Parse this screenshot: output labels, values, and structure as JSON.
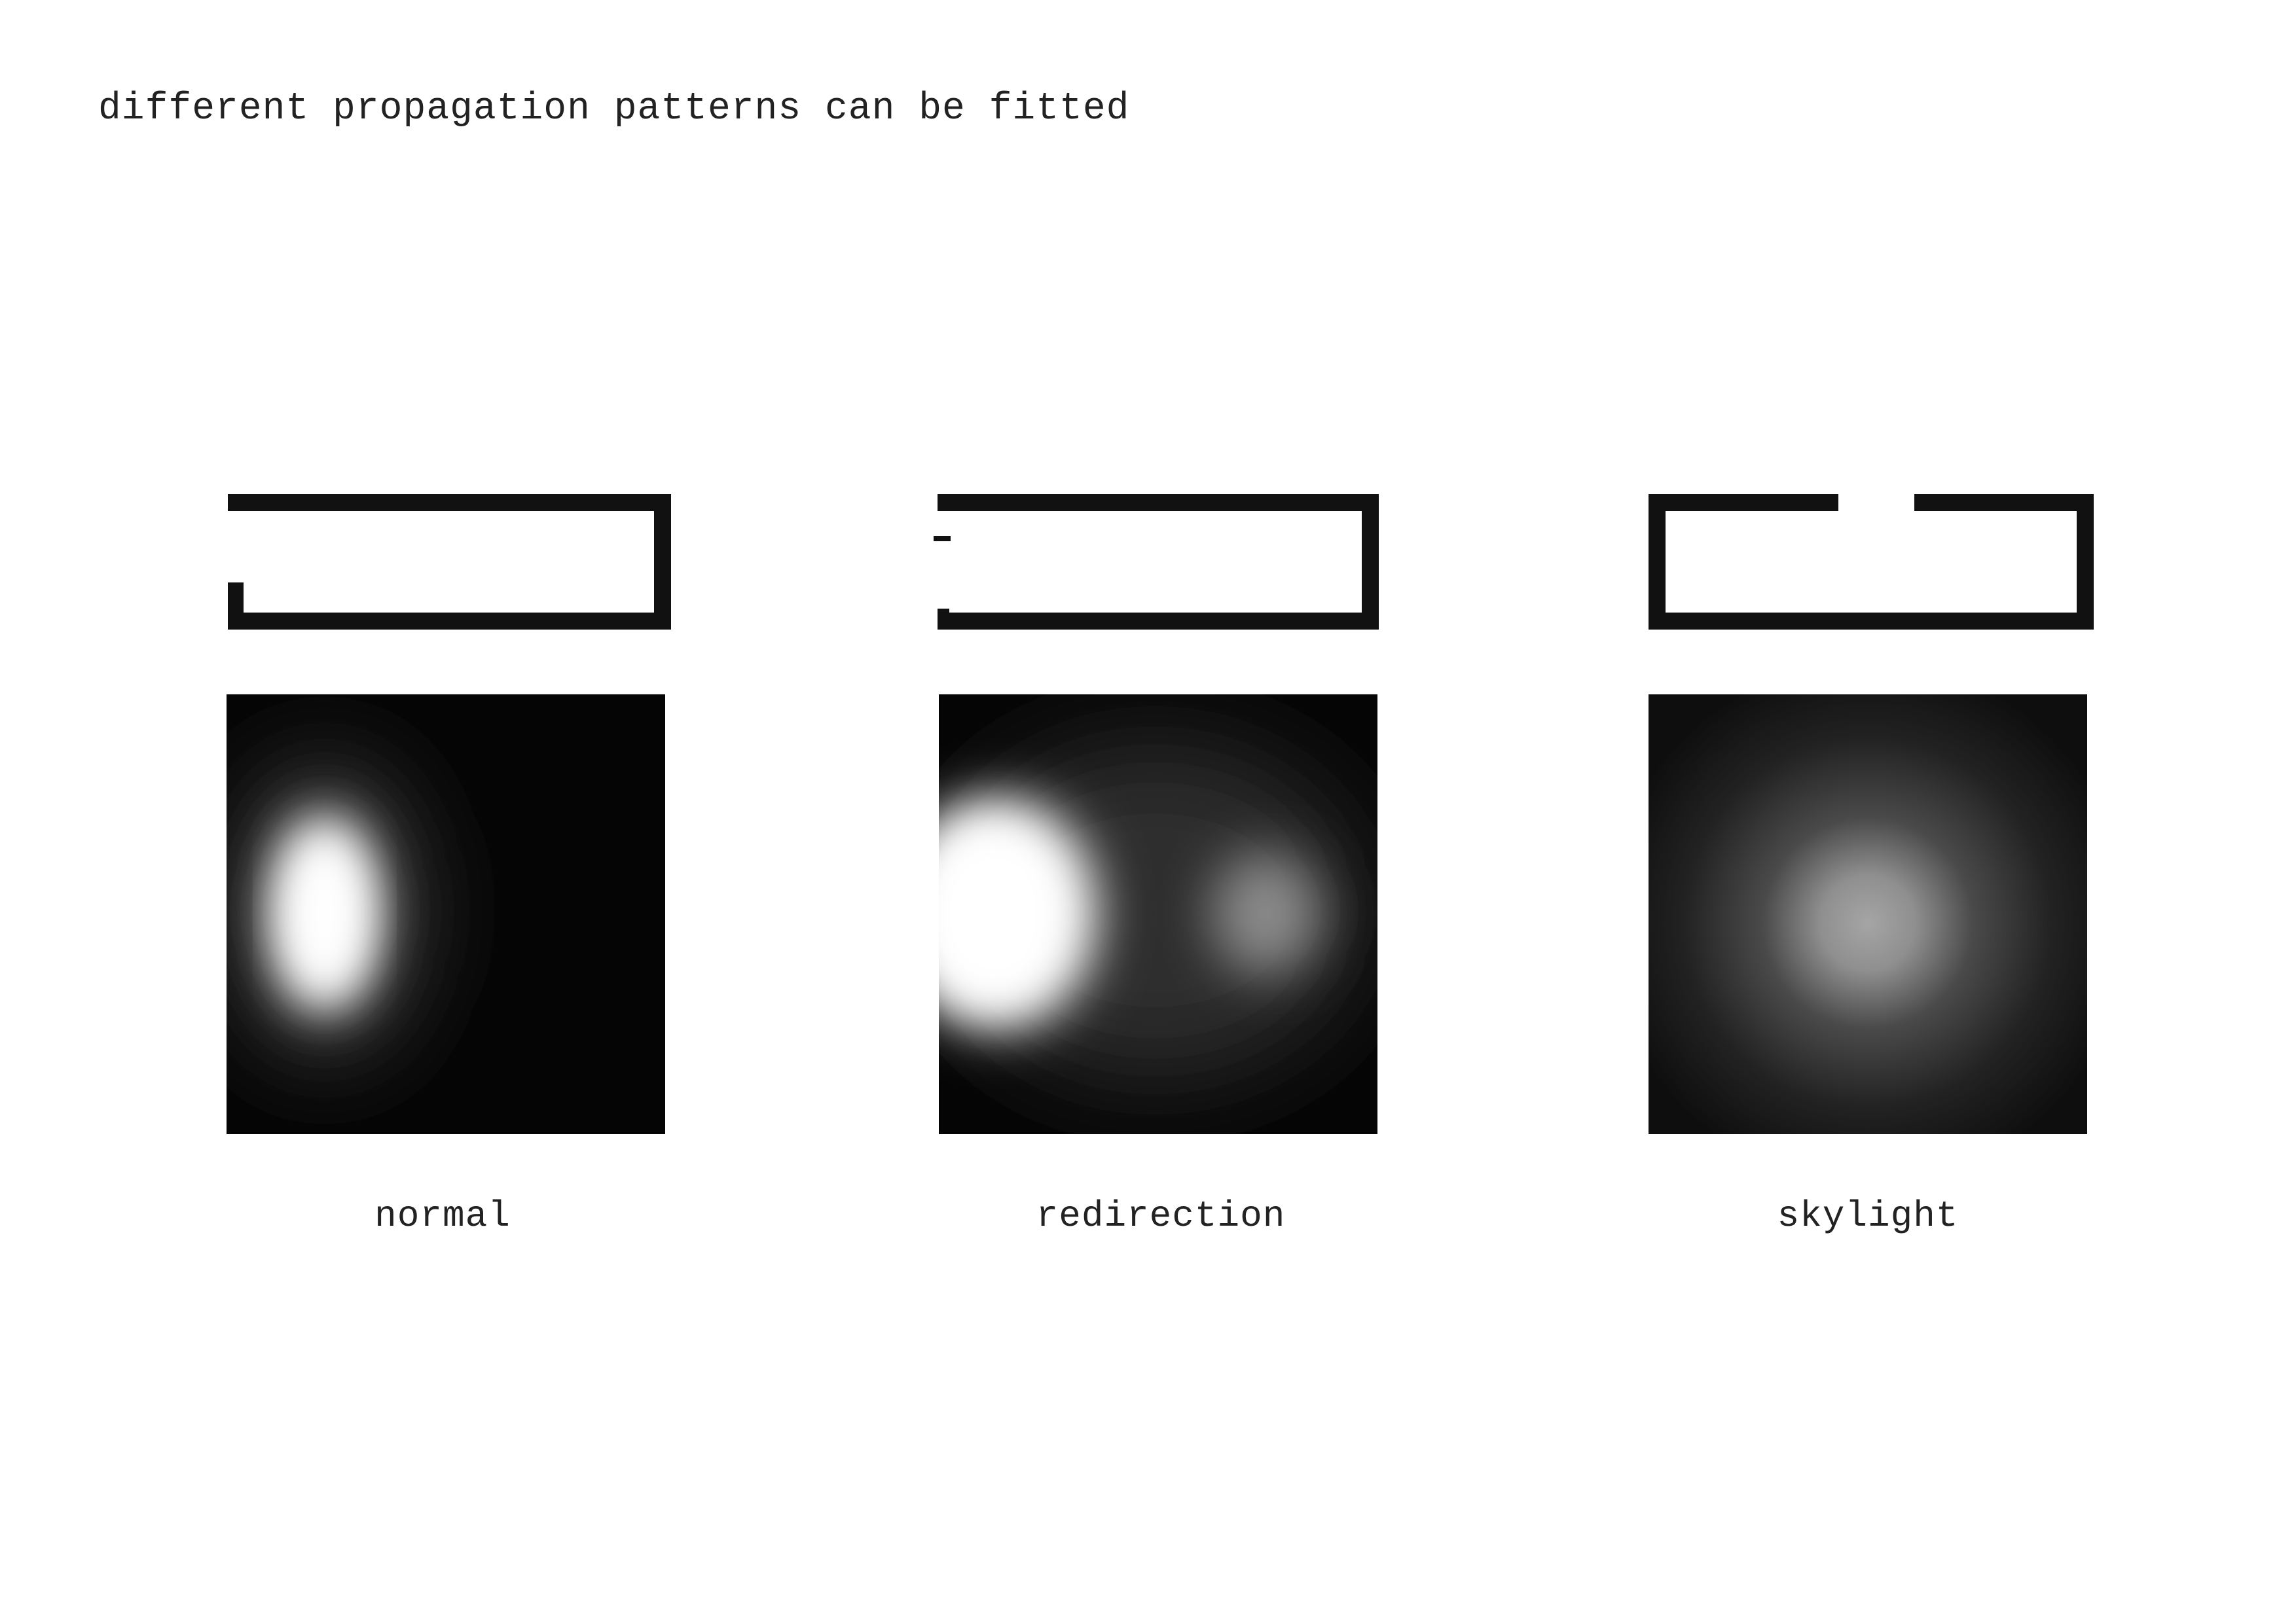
{
  "title": "different propagation patterns can be fitted",
  "panels": [
    {
      "key": "normal",
      "caption": "normal"
    },
    {
      "key": "redirection",
      "caption": "redirection"
    },
    {
      "key": "skylight",
      "caption": "skylight"
    }
  ],
  "colors": {
    "wall": "#111111",
    "heatmap_background": "#050505",
    "light": "#ffffff",
    "text": "#222222"
  }
}
